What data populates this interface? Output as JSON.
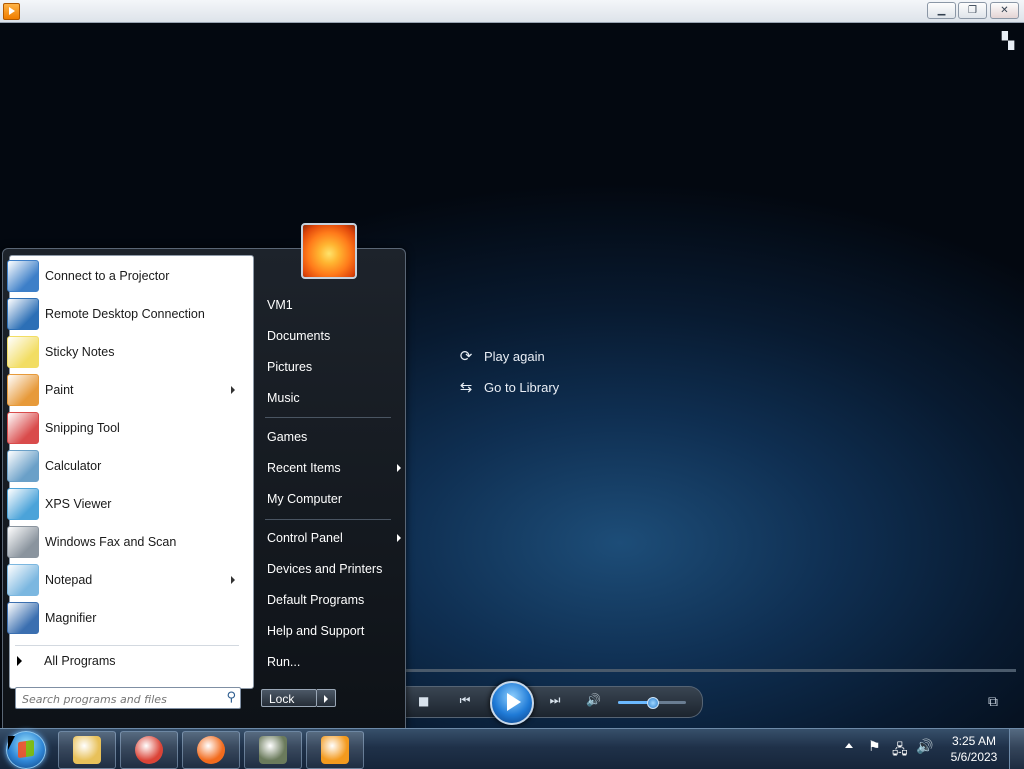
{
  "window": {
    "caption_buttons": {
      "minimize": "▁",
      "restore": "❐",
      "close": "✕"
    }
  },
  "player": {
    "overlay_actions": [
      {
        "label": "Play again",
        "icon": "replay-icon"
      },
      {
        "label": "Go to Library",
        "icon": "library-icon"
      }
    ],
    "volume_level": 0.5
  },
  "start_menu": {
    "programs": [
      {
        "label": "Connect to a Projector",
        "icon": "projector-icon",
        "color": "#3d7fc8",
        "submenu": false
      },
      {
        "label": "Remote Desktop Connection",
        "icon": "remote-desktop-icon",
        "color": "#2c6fb6",
        "submenu": false
      },
      {
        "label": "Sticky Notes",
        "icon": "sticky-notes-icon",
        "color": "#f2dd63",
        "submenu": false
      },
      {
        "label": "Paint",
        "icon": "paint-icon",
        "color": "#e79a3a",
        "submenu": true
      },
      {
        "label": "Snipping Tool",
        "icon": "scissors-icon",
        "color": "#d94b4b",
        "submenu": false
      },
      {
        "label": "Calculator",
        "icon": "calculator-icon",
        "color": "#6aa0c8",
        "submenu": false
      },
      {
        "label": "XPS Viewer",
        "icon": "xps-icon",
        "color": "#4ba3d9",
        "submenu": false
      },
      {
        "label": "Windows Fax and Scan",
        "icon": "fax-icon",
        "color": "#8a949e",
        "submenu": false
      },
      {
        "label": "Notepad",
        "icon": "notepad-icon",
        "color": "#7bb7e0",
        "submenu": true
      },
      {
        "label": "Magnifier",
        "icon": "magnifier-icon",
        "color": "#3b6fb0",
        "submenu": false
      }
    ],
    "all_programs": "All Programs",
    "search_placeholder": "Search programs and files",
    "right_items": [
      {
        "label": "VM1",
        "submenu": false
      },
      {
        "label": "Documents",
        "submenu": false
      },
      {
        "label": "Pictures",
        "submenu": false
      },
      {
        "label": "Music",
        "submenu": false
      },
      {
        "label": "Games",
        "submenu": false
      },
      {
        "label": "Recent Items",
        "submenu": true
      },
      {
        "label": "My Computer",
        "submenu": false
      },
      {
        "label": "Control Panel",
        "submenu": true
      },
      {
        "label": "Devices and Printers",
        "submenu": false
      },
      {
        "label": "Default Programs",
        "submenu": false
      },
      {
        "label": "Help and Support",
        "submenu": false
      },
      {
        "label": "Run...",
        "submenu": false
      }
    ],
    "lock_label": "Lock"
  },
  "taskbar": {
    "apps": [
      {
        "name": "file-explorer",
        "icon": "folder-icon",
        "color": "#e8c15a"
      },
      {
        "name": "chrome",
        "icon": "chrome-icon",
        "color": "#db4437"
      },
      {
        "name": "firefox",
        "icon": "firefox-icon",
        "color": "#f26b1d"
      },
      {
        "name": "app-4",
        "icon": "window-app-icon",
        "color": "#6b7b5c"
      },
      {
        "name": "media-player",
        "icon": "media-player-icon",
        "color": "#f39a1e"
      }
    ],
    "clock_time": "3:25 AM",
    "clock_date": "5/6/2023"
  }
}
